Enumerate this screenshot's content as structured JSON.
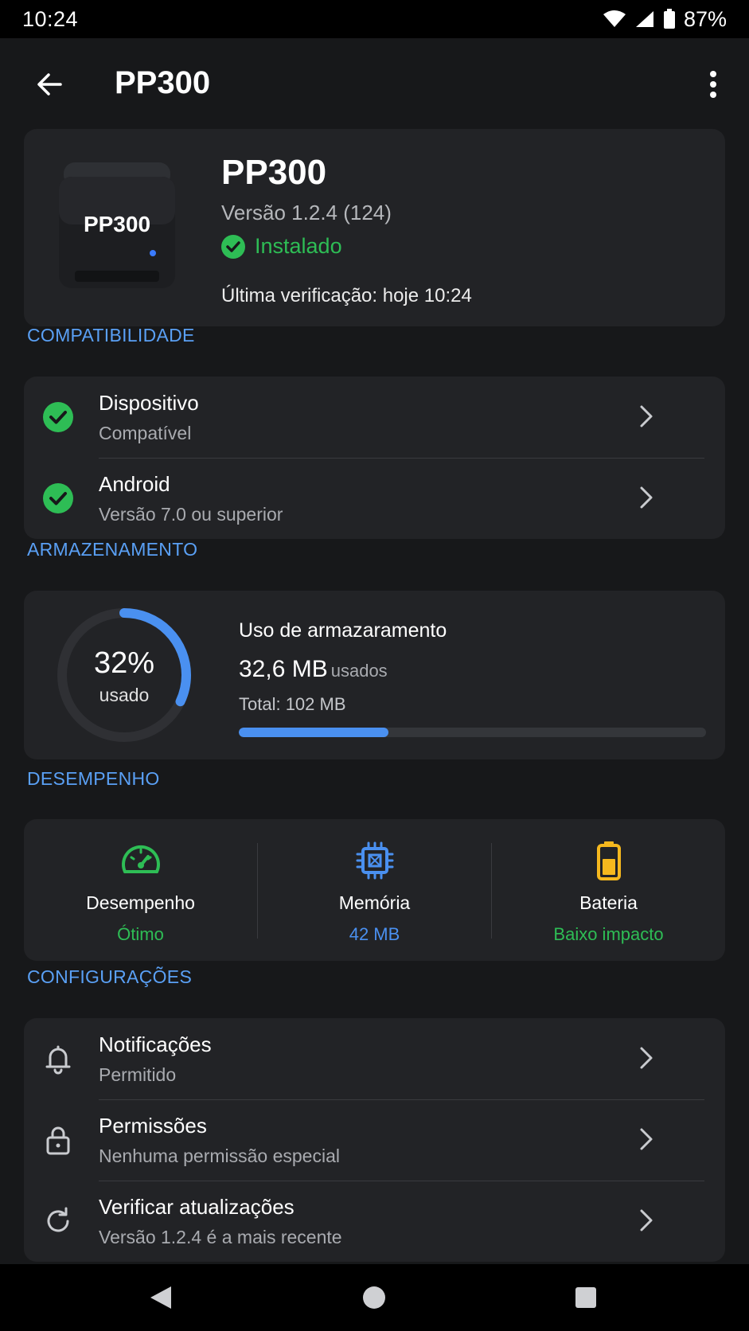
{
  "status_bar": {
    "time": "10:24",
    "battery": "87%"
  },
  "app_bar": {
    "title": "PP300"
  },
  "hero": {
    "printer_badge": "PP300",
    "name": "PP300",
    "version": "Versão 1.2.4 (124)",
    "status": "Instalado",
    "last_check": "Última verificação: hoje 10:24"
  },
  "compat": {
    "label": "COMPATIBILIDADE",
    "items": [
      {
        "title": "Dispositivo",
        "subtitle": "Compatível"
      },
      {
        "title": "Android",
        "subtitle": "Versão 7.0 ou superior"
      }
    ]
  },
  "storage": {
    "label": "ARMAZENAMENTO",
    "ring_percent": "32%",
    "ring_label": "usado",
    "percent_value": 32,
    "title": "Uso de armazaramento",
    "used": "32,6 MB",
    "used_suffix": "usados",
    "total": "Total: 102 MB"
  },
  "performance": {
    "label": "DESEMPENHO",
    "items": [
      {
        "label": "Desempenho",
        "value": "Ótimo",
        "color": "#2ebd55",
        "icon": "speedometer-icon"
      },
      {
        "label": "Memória",
        "value": "42 MB",
        "color": "#4a90f0",
        "icon": "chip-icon"
      },
      {
        "label": "Bateria",
        "value": "Baixo impacto",
        "color": "#2ebd55",
        "icon": "battery-icon"
      }
    ]
  },
  "config": {
    "label": "CONFIGURAÇÕES",
    "items": [
      {
        "title": "Notificações",
        "subtitle": "Permitido",
        "icon": "bell-icon"
      },
      {
        "title": "Permissões",
        "subtitle": "Nenhuma permissão especial",
        "icon": "lock-icon"
      },
      {
        "title": "Verificar atualizações",
        "subtitle": "Versão 1.2.4 é a mais recente",
        "icon": "refresh-icon"
      }
    ]
  },
  "colors": {
    "accent": "#4a90f0",
    "success": "#2ebd55",
    "warning": "#f5b81e",
    "background": "#17181a",
    "card": "#222326"
  }
}
